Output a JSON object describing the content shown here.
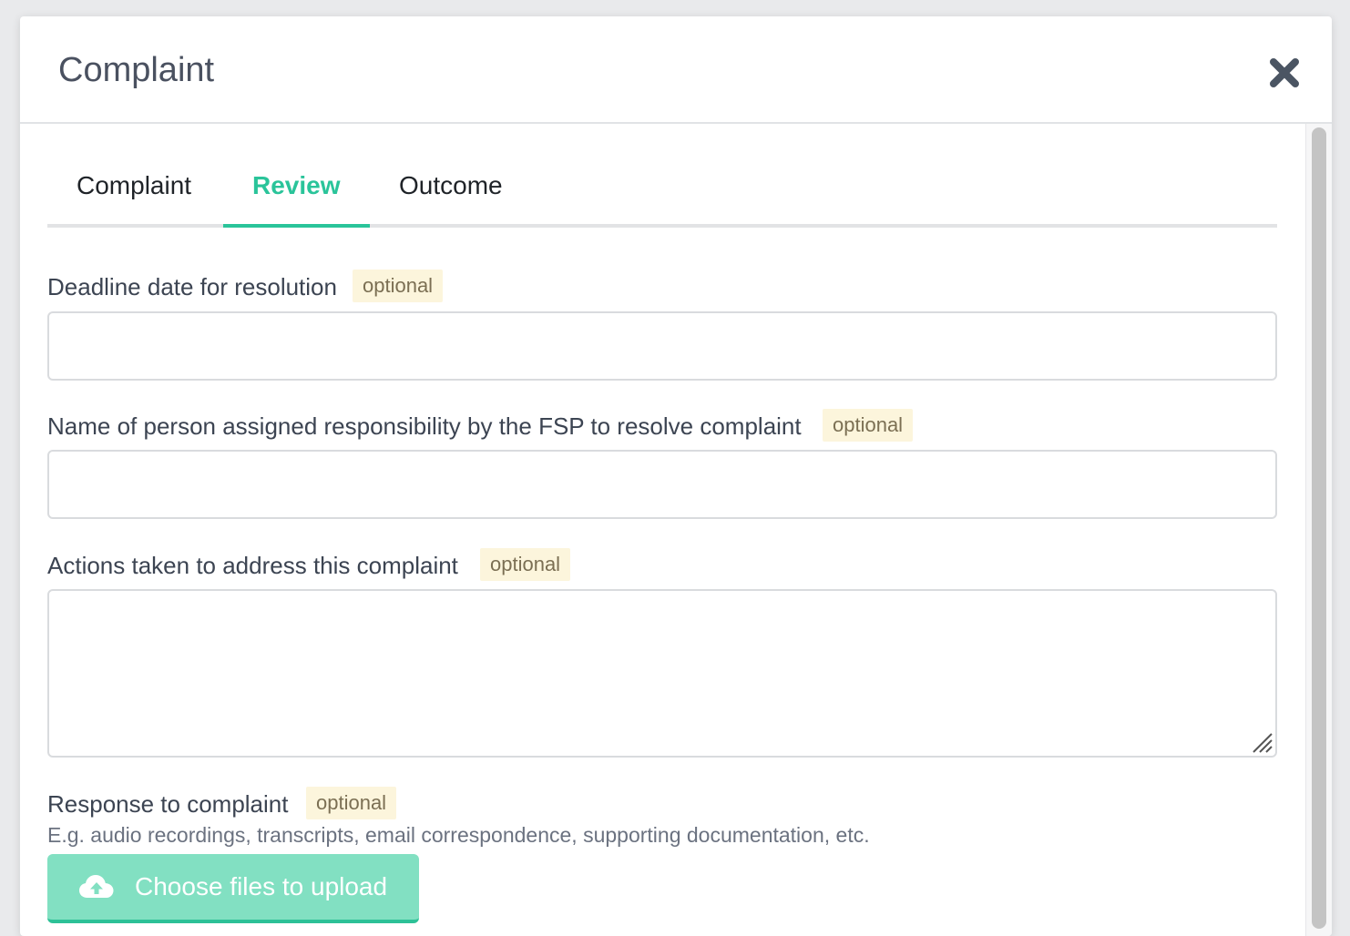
{
  "modal": {
    "title": "Complaint"
  },
  "tabs": [
    {
      "label": "Complaint",
      "active": false
    },
    {
      "label": "Review",
      "active": true
    },
    {
      "label": "Outcome",
      "active": false
    }
  ],
  "fields": {
    "deadline": {
      "label": "Deadline date for resolution",
      "badge": "optional",
      "value": ""
    },
    "assignee": {
      "label": "Name of person assigned responsibility by the FSP to resolve complaint",
      "badge": "optional",
      "value": ""
    },
    "actions": {
      "label": "Actions taken to address this complaint",
      "badge": "optional",
      "value": ""
    },
    "response": {
      "label": "Response to complaint",
      "badge": "optional",
      "help": "E.g. audio recordings, transcripts, email correspondence, supporting documentation, etc.",
      "upload_label": "Choose files to upload"
    }
  },
  "colors": {
    "accent": "#2ac49a",
    "upload_button": "#82e0c2",
    "badge_bg": "#fcf5dc"
  },
  "icons": {
    "close": "close-icon",
    "upload": "cloud-upload-icon"
  }
}
